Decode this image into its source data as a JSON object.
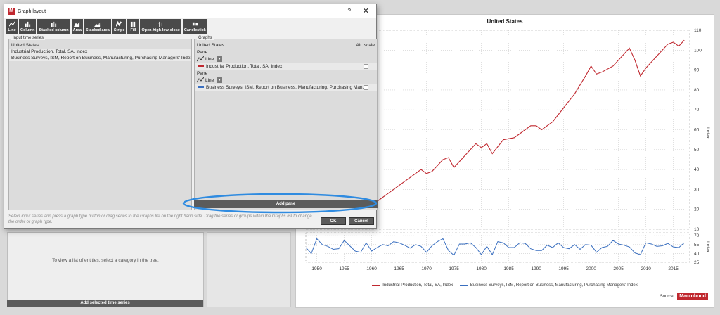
{
  "dialog": {
    "title": "Graph layout",
    "help": "?",
    "close": "✕",
    "toolbar": [
      {
        "label": "Line",
        "icon": "line-chart-icon"
      },
      {
        "label": "Column",
        "icon": "column-chart-icon"
      },
      {
        "label": "Stacked column",
        "icon": "stacked-column-icon"
      },
      {
        "label": "Area",
        "icon": "area-chart-icon"
      },
      {
        "label": "Stacked area",
        "icon": "stacked-area-icon"
      },
      {
        "label": "Stripe",
        "icon": "stripe-icon"
      },
      {
        "label": "Fill",
        "icon": "fill-icon"
      },
      {
        "label": "Open-high-low-close",
        "icon": "ohlc-icon"
      },
      {
        "label": "Candlestick",
        "icon": "candlestick-icon"
      }
    ],
    "input_panel": {
      "label": "Input time series",
      "rows": [
        "United States",
        "Industrial Production, Total, SA, Index",
        "Business Surveys, ISM, Report on Business, Manufacturing, Purchasing Managers' Index"
      ]
    },
    "graphs_panel": {
      "label": "Graphs",
      "header_left": "United States",
      "header_right": "Alt. scale",
      "panes": [
        {
          "label": "Pane",
          "type": "Line",
          "series": "Industrial Production, Total, SA, Index",
          "color": "#c0282f"
        },
        {
          "label": "Pane",
          "type": "Line",
          "series": "Business Surveys, ISM, Report on Business, Manufacturing, Purchasing Man...",
          "color": "#3a6fc0"
        }
      ],
      "add_pane": "Add pane"
    },
    "hint": "Select input series and press a graph type button or drag series to the Graphs list on the right hand side. Drag the series or groups within the Graphs list to change the order or graph type.",
    "ok": "OK",
    "cancel": "Cancel"
  },
  "background": {
    "left_hint": "To view a list of entities, select a category in the tree.",
    "add_selected": "Add selected time series"
  },
  "chart_window": {
    "source_label": "Source:",
    "source_logo": "Macrobond"
  },
  "chart_data": [
    {
      "type": "line",
      "title": "United States",
      "ylabel": "Index",
      "ylim": [
        10,
        110
      ],
      "yticks": [
        10,
        20,
        30,
        40,
        50,
        60,
        70,
        80,
        90,
        100,
        110
      ],
      "xlim": [
        1948,
        2018
      ],
      "xticks": [
        1950,
        1955,
        1960,
        1965,
        1970,
        1975,
        1980,
        1985,
        1990,
        1995,
        2000,
        2005,
        2010,
        2015
      ],
      "series": [
        {
          "name": "Industrial Production, Total, SA, Index",
          "color": "#c0282f",
          "x": [
            1961,
            1963,
            1965,
            1967,
            1969,
            1970,
            1971,
            1973,
            1974,
            1975,
            1977,
            1979,
            1980,
            1981,
            1982,
            1984,
            1986,
            1988,
            1989,
            1990,
            1991,
            1993,
            1995,
            1997,
            1999,
            2000,
            2001,
            2002,
            2004,
            2006,
            2007,
            2008,
            2009,
            2010,
            2012,
            2014,
            2015,
            2016,
            2017
          ],
          "y": [
            24,
            28,
            32,
            36,
            40,
            38,
            39,
            45,
            46,
            41,
            47,
            53,
            51,
            53,
            48,
            55,
            56,
            60,
            62,
            62,
            60,
            64,
            71,
            78,
            87,
            92,
            88,
            89,
            92,
            98,
            101,
            95,
            87,
            91,
            97,
            103,
            104,
            102,
            105
          ]
        },
        {
          "name": "Business Surveys, ISM, Report on Business, Manufacturing, Purchasing Managers' Index",
          "color": "#3a6fc0",
          "ylim": [
            25,
            75
          ],
          "yticks": [
            25,
            40,
            55,
            70
          ],
          "x": [
            1948,
            1949,
            1950,
            1951,
            1952,
            1953,
            1954,
            1955,
            1956,
            1957,
            1958,
            1959,
            1960,
            1961,
            1962,
            1963,
            1964,
            1965,
            1966,
            1967,
            1968,
            1969,
            1970,
            1971,
            1972,
            1973,
            1974,
            1975,
            1976,
            1977,
            1978,
            1979,
            1980,
            1981,
            1982,
            1983,
            1984,
            1985,
            1986,
            1987,
            1988,
            1989,
            1990,
            1991,
            1992,
            1993,
            1994,
            1995,
            1996,
            1997,
            1998,
            1999,
            2000,
            2001,
            2002,
            2003,
            2004,
            2005,
            2006,
            2007,
            2008,
            2009,
            2010,
            2011,
            2012,
            2013,
            2014,
            2015,
            2016,
            2017
          ],
          "y": [
            50,
            40,
            65,
            55,
            52,
            47,
            48,
            62,
            53,
            44,
            42,
            58,
            44,
            50,
            55,
            53,
            60,
            58,
            54,
            49,
            55,
            52,
            42,
            53,
            60,
            65,
            45,
            37,
            56,
            56,
            58,
            50,
            38,
            52,
            38,
            60,
            58,
            50,
            50,
            58,
            57,
            48,
            45,
            45,
            54,
            50,
            58,
            50,
            48,
            55,
            47,
            55,
            54,
            42,
            50,
            52,
            62,
            56,
            54,
            51,
            41,
            38,
            58,
            56,
            52,
            53,
            57,
            51,
            50,
            58
          ]
        }
      ]
    }
  ]
}
